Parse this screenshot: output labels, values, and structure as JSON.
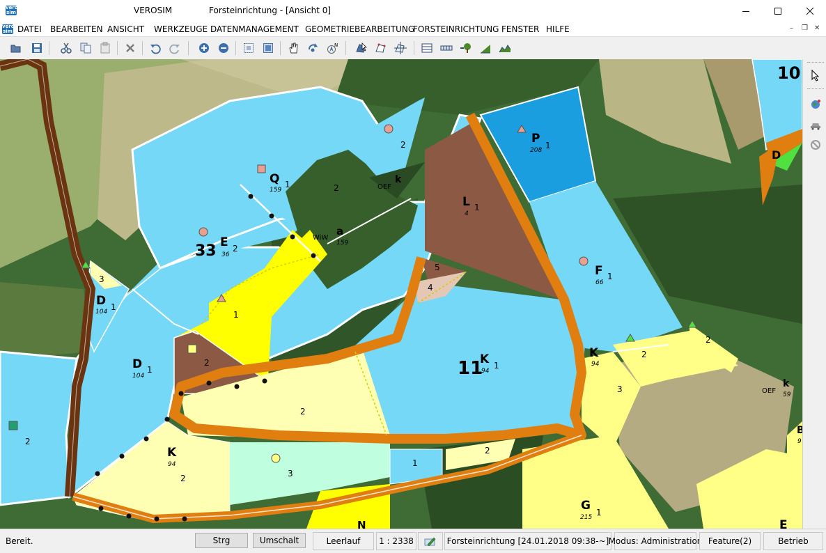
{
  "window": {
    "app_name": "VEROSIM",
    "document_title": "Forsteinrichtung  - [Ansicht 0]",
    "logo_text": "vero sim"
  },
  "menu": {
    "items": [
      "DATEI",
      "BEARBEITEN",
      "ANSICHT",
      "WERKZEUGE",
      "DATENMANAGEMENT",
      "GEOMETRIEBEARBEITUNG",
      "FORSTEINRICHTUNG",
      "FENSTER",
      "HILFE"
    ]
  },
  "toolbar": {
    "icons": [
      "open-folder-icon",
      "save-icon",
      "cut-icon",
      "copy-icon",
      "paste-icon",
      "delete-icon",
      "undo-icon",
      "redo-icon",
      "zoom-in-icon",
      "zoom-out-icon",
      "zoom-window-icon",
      "zoom-extent-icon",
      "pan-hand-icon",
      "rotate-icon",
      "north-arrow-icon",
      "select-feature-icon",
      "edit-feature-icon",
      "measure-icon",
      "table-view-icon",
      "attribute-bar-icon",
      "tree-symbol-icon",
      "stand-profile-icon",
      "terrain-icon"
    ]
  },
  "map": {
    "labels": {
      "compartment_33": "33",
      "compartment_11": "11",
      "compartment_10": "10",
      "e_letter": "E",
      "e_num": "36",
      "e_sub": "2",
      "q_letter": "Q",
      "q_num": "159",
      "q_sub": "1",
      "p_letter": "P",
      "p_num": "208",
      "p_sub": "1",
      "l_letter": "L",
      "l_num": "4",
      "l_sub": "1",
      "f_letter": "F",
      "f_num": "66",
      "f_sub": "1",
      "k_center_letter": "K",
      "k_center_num": "94",
      "k_center_sub": "1",
      "k_right_letter": "K",
      "k_right_num": "94",
      "k_bottom_letter": "K",
      "k_bottom_num": "94",
      "k_bottom_sub": "2",
      "d_left_letter": "D",
      "d_left_num": "104",
      "d_left_sub": "1",
      "d_mid_letter": "D",
      "d_mid_num": "104",
      "d_mid_sub": "1",
      "d_right_letter": "D",
      "g_letter": "G",
      "g_num": "215",
      "g_sub": "1",
      "wiw": "WiW",
      "wiw_a": "a",
      "wiw_num": "159",
      "oef_top": "OEF",
      "oef_top_k": "k",
      "oef_right": "OEF",
      "oef_right_k": "k",
      "oef_right_num": "59",
      "e_bottom": "E",
      "n_bottom": "N",
      "b_right": "B",
      "b_right_num": "9",
      "n2a": "2",
      "n2b": "2",
      "n2c": "2",
      "n2d": "2",
      "n2e": "2",
      "n2f": "2",
      "n2g": "2",
      "n2h": "2",
      "n1a": "1",
      "n1b": "1",
      "n3a": "3",
      "n3b": "3",
      "n3c": "3",
      "n4": "4",
      "n5": "5"
    }
  },
  "side_toolbar": {
    "icons": [
      "pointer-icon",
      "globe-icon",
      "vehicle-icon",
      "no-entry-icon"
    ]
  },
  "status": {
    "text": "Bereit.",
    "key_strg": "Strg",
    "key_umschalt": "Umschalt",
    "mode_idle": "Leerlauf",
    "scale": "1 : 2338",
    "project": "Forsteinrichtung [24.01.2018 09:38-~]",
    "modus": "Modus: Administration",
    "feature": "Feature(2)",
    "betrieb": "Betrieb"
  },
  "colors": {
    "stand_light_blue": "#74d8f6",
    "stand_blue": "#1a9ee0",
    "stand_yellow": "#ffff00",
    "stand_light_yellow": "#ffffb4",
    "stand_brown": "#8c5a44",
    "road_orange": "#e07f10",
    "road_dark_brown": "#6b3410",
    "forest_dark": "#345c2c",
    "meadow": "#9aae6e"
  }
}
